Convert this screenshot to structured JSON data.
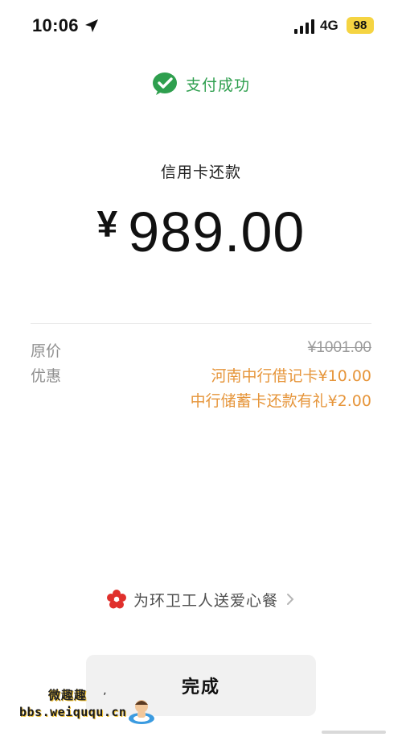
{
  "status_bar": {
    "time": "10:06",
    "network": "4G",
    "battery": "98",
    "battery_color": "#f5d442",
    "icons": [
      "location-arrow-icon",
      "cellular-signal-icon"
    ]
  },
  "header": {
    "success_text": "支付成功",
    "success_icon": "wechat-pay-check-icon",
    "accent_color": "#2e9f4e"
  },
  "payment": {
    "type": "信用卡还款",
    "currency": "¥",
    "amount": "989.00"
  },
  "details": {
    "original_label": "原价",
    "original_value": "¥1001.00",
    "discount_label": "优惠",
    "discounts": [
      "河南中行借记卡¥10.00",
      "中行储蓄卡还款有礼¥2.00"
    ],
    "discount_color": "#e6953a"
  },
  "charity": {
    "icon": "red-flower-icon",
    "text": "为环卫工人送爱心餐"
  },
  "actions": {
    "done_label": "完成"
  },
  "watermark": {
    "line1": "微趣趣",
    "line2": "bbs.weiququ.cn"
  }
}
